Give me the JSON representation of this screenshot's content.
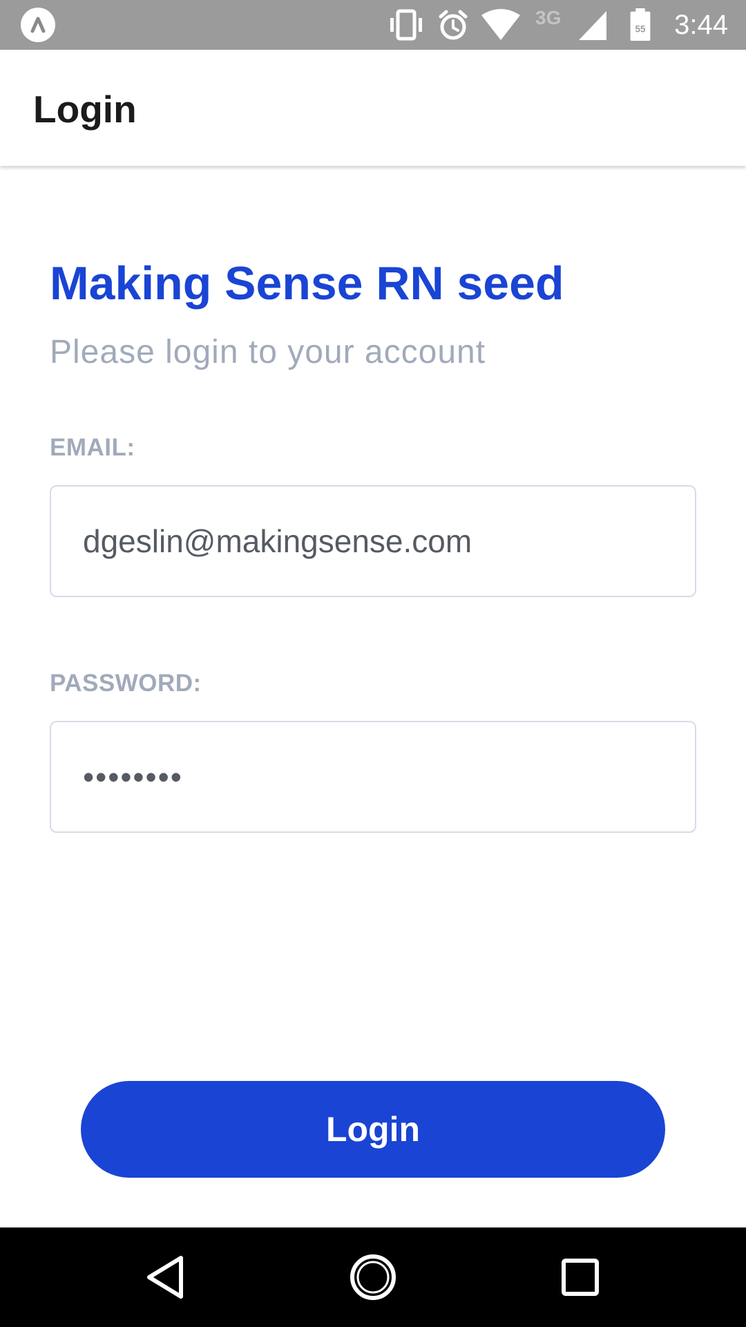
{
  "status_bar": {
    "time": "3:44",
    "network": "3G",
    "battery_level": "55",
    "icons": [
      "expo-icon",
      "vibrate-icon",
      "alarm-icon",
      "wifi-icon",
      "signal-icon",
      "battery-icon"
    ]
  },
  "app_bar": {
    "title": "Login"
  },
  "login_form": {
    "heading": "Making Sense RN seed",
    "subheading": "Please login to your account",
    "email": {
      "label": "EMAIL:",
      "value": "dgeslin@makingsense.com"
    },
    "password": {
      "label": "PASSWORD:",
      "value": "••••••••"
    },
    "submit_label": "Login"
  },
  "nav_bar": {
    "icons": [
      "back-icon",
      "home-icon",
      "recents-icon"
    ]
  },
  "colors": {
    "accent": "#1a44d4",
    "muted_text": "#a1aabb",
    "status_bar": "#9b9b9b",
    "nav_bar": "#000000"
  }
}
